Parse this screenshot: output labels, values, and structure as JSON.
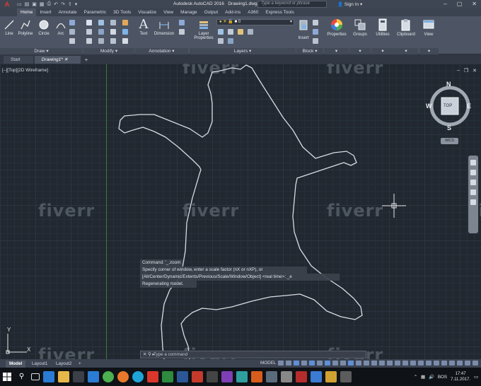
{
  "app": {
    "logo": "A",
    "title": "Autodesk AutoCAD 2016",
    "document": "Drawing1.dwg",
    "search_placeholder": "Type a keyword or phrase",
    "signin": "Sign In",
    "accent_color": "#e03a2f"
  },
  "ribbon_tabs": [
    "Home",
    "Insert",
    "Annotate",
    "Parametric",
    "3D Tools",
    "Visualize",
    "View",
    "Manage",
    "Output",
    "Add-ins",
    "A360",
    "Express Tools"
  ],
  "ribbon": {
    "draw": {
      "title": "Draw",
      "line": "Line",
      "polyline": "Polyline",
      "circle": "Circle",
      "arc": "Arc"
    },
    "modify": {
      "title": "Modify"
    },
    "annotation": {
      "title": "Annotation",
      "text": "Text",
      "dimension": "Dimension"
    },
    "layers": {
      "title": "Layers",
      "properties_line1": "Layer",
      "properties_line2": "Properties",
      "current_layer": "0"
    },
    "block": {
      "title": "Block",
      "insert": "Insert"
    },
    "properties": {
      "label": "Properties"
    },
    "groups": {
      "label": "Groups"
    },
    "utilities": {
      "label": "Utilities"
    },
    "clipboard": {
      "label": "Clipboard"
    },
    "view": {
      "label": "View"
    }
  },
  "file_tabs": [
    {
      "label": "Start"
    },
    {
      "label": "Drawing1*"
    }
  ],
  "viewport": {
    "label": "[–][Top][2D Wireframe]",
    "watermark": "fiverr",
    "viewcube": {
      "n": "N",
      "s": "S",
      "e": "E",
      "w": "W",
      "face": "TOP",
      "wcs": "WCS"
    },
    "ucs": {
      "x": "X",
      "y": "Y"
    }
  },
  "command": {
    "history": [
      "Command: '_.zoom",
      "Specify corner of window, enter a scale factor (nX or nXP), or",
      "[All/Center/Dynamic/Extents/Previous/Scale/Window/Object] <real time>: _e",
      "Regenerating model."
    ],
    "input_placeholder": "Type a command"
  },
  "layout_tabs": [
    "Model",
    "Layout1",
    "Layout2"
  ],
  "status": {
    "model": "MODEL"
  },
  "taskbar": {
    "lang": "BOS",
    "time": "17:47",
    "date": "7.11.2017."
  }
}
